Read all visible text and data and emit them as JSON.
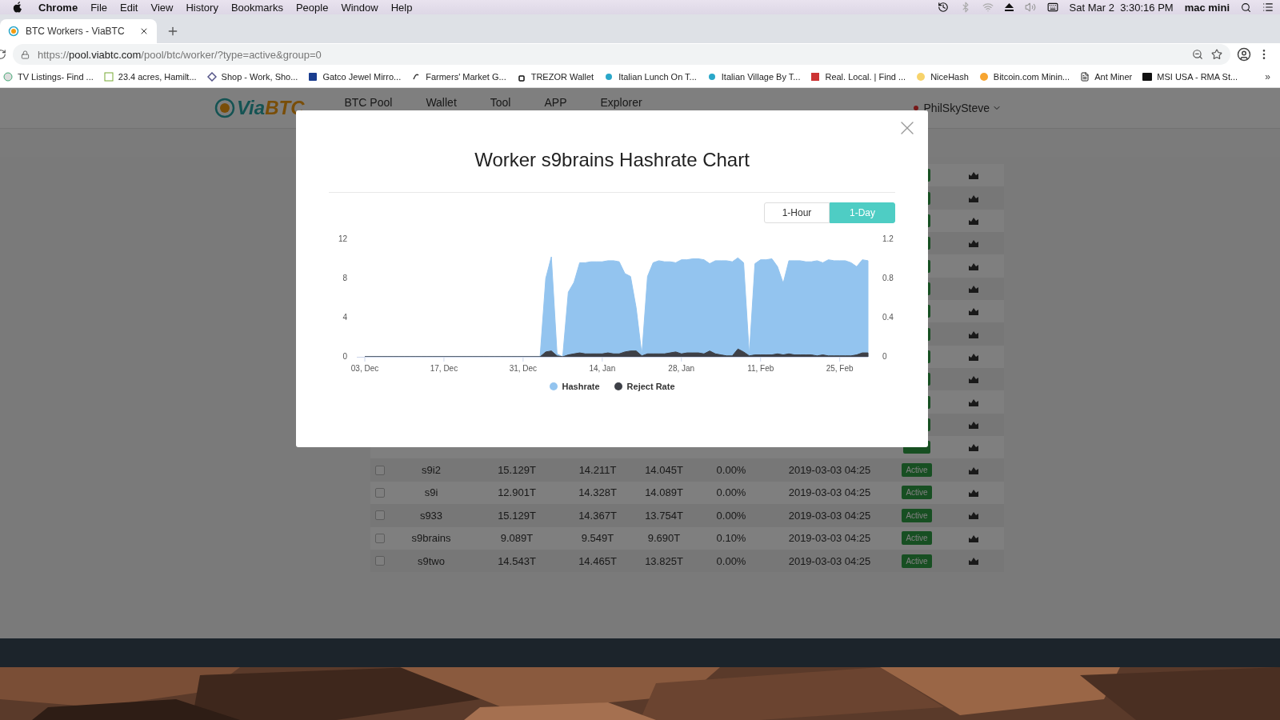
{
  "menu_bar": {
    "app": "Chrome",
    "items": [
      "File",
      "Edit",
      "View",
      "History",
      "Bookmarks",
      "People",
      "Window",
      "Help"
    ],
    "clock": "Sat Mar 2  3:30:16 PM",
    "user": "mac mini"
  },
  "browser": {
    "tab": {
      "title": "BTC Workers - ViaBTC",
      "selected": true
    },
    "url": {
      "scheme": "https://",
      "host": "pool.viabtc.com",
      "path": "/pool/btc/worker/?type=active&group=0"
    },
    "bookmarks": [
      "TV Listings- Find ...",
      "23.4 acres, Hamilt...",
      "Shop - Work, Sho...",
      "Gatco Jewel Mirro...",
      "Farmers' Market G...",
      "TREZOR Wallet",
      "Italian Lunch On T...",
      "Italian Village By T...",
      "Real. Local. | Find ...",
      "NiceHash",
      "Bitcoin.com Minin...",
      "Ant Miner",
      "MSI USA - RMA St..."
    ],
    "more": "»"
  },
  "site": {
    "logo_parts": [
      "Via",
      "BTC"
    ],
    "nav": [
      "BTC Pool",
      "Wallet",
      "Tool",
      "APP",
      "Explorer"
    ],
    "account": "PhilSkySteve"
  },
  "table": {
    "rows": [
      {
        "kind": "covered"
      },
      {
        "kind": "covered"
      },
      {
        "kind": "covered"
      },
      {
        "kind": "covered"
      },
      {
        "kind": "covered"
      },
      {
        "kind": "covered"
      },
      {
        "kind": "covered"
      },
      {
        "kind": "covered"
      },
      {
        "kind": "covered"
      },
      {
        "kind": "covered"
      },
      {
        "kind": "covered"
      },
      {
        "kind": "covered"
      },
      {
        "kind": "covered"
      },
      {
        "kind": "worker",
        "checked": false,
        "cells": [
          "s9i2",
          "15.129T",
          "14.211T",
          "14.045T",
          "0.00%",
          "2019-03-03 04:25"
        ],
        "status": "Active"
      },
      {
        "kind": "worker",
        "checked": false,
        "cells": [
          "s9i",
          "12.901T",
          "14.328T",
          "14.089T",
          "0.00%",
          "2019-03-03 04:25"
        ],
        "status": "Active"
      },
      {
        "kind": "worker",
        "checked": false,
        "cells": [
          "s933",
          "15.129T",
          "14.367T",
          "13.754T",
          "0.00%",
          "2019-03-03 04:25"
        ],
        "status": "Active"
      },
      {
        "kind": "worker",
        "checked": false,
        "cells": [
          "s9brains",
          "9.089T",
          "9.549T",
          "9.690T",
          "0.10%",
          "2019-03-03 04:25"
        ],
        "status": "Active"
      },
      {
        "kind": "worker",
        "checked": false,
        "cells": [
          "s9two",
          "14.543T",
          "14.465T",
          "13.825T",
          "0.00%",
          "2019-03-03 04:25"
        ],
        "status": "Active"
      }
    ]
  },
  "modal": {
    "title": "Worker s9brains Hashrate Chart",
    "ranges": [
      {
        "label": "1-Hour",
        "selected": false
      },
      {
        "label": "1-Day",
        "selected": true
      }
    ],
    "chart_data": {
      "type": "area",
      "categories": [
        "03, Dec",
        null,
        null,
        null,
        null,
        null,
        null,
        null,
        null,
        null,
        null,
        null,
        null,
        null,
        "17, Dec",
        null,
        null,
        null,
        null,
        null,
        null,
        null,
        null,
        null,
        null,
        null,
        null,
        null,
        "31, Dec",
        null,
        null,
        null,
        null,
        null,
        null,
        null,
        null,
        null,
        null,
        null,
        null,
        null,
        "14, Jan",
        null,
        null,
        null,
        null,
        null,
        null,
        null,
        null,
        null,
        null,
        null,
        null,
        null,
        "28, Jan",
        null,
        null,
        null,
        null,
        null,
        null,
        null,
        null,
        null,
        null,
        null,
        null,
        null,
        "11, Feb",
        null,
        null,
        null,
        null,
        null,
        null,
        null,
        null,
        null,
        null,
        null,
        null,
        null,
        "25, Feb",
        null,
        null,
        null,
        null,
        null
      ],
      "ylim": [
        0,
        12
      ],
      "yticks": [
        0,
        4,
        8,
        12
      ],
      "y2lim": [
        0,
        1.2
      ],
      "y2ticks": [
        {
          "value": 0,
          "label": "0"
        },
        {
          "value": 0.4,
          "label": "0.4"
        },
        {
          "value": 0.8,
          "label": "0.8"
        },
        {
          "value": 1.2,
          "label": "1.2"
        }
      ],
      "series": [
        {
          "name": "Hashrate",
          "color": "#93c4ef",
          "values": [
            0,
            0,
            0,
            0,
            0,
            0,
            0,
            0,
            0,
            0,
            0,
            0,
            0,
            0,
            0,
            0,
            0,
            0,
            0,
            0,
            0,
            0,
            0,
            0,
            0,
            0,
            0,
            0,
            0,
            0,
            0,
            0,
            8,
            10.2,
            0.3,
            0,
            6.6,
            7.6,
            9.6,
            9.6,
            9.7,
            9.7,
            9.7,
            9.8,
            9.8,
            9.7,
            8.5,
            8.2,
            5,
            0.2,
            8.2,
            9.6,
            9.8,
            9.7,
            9.7,
            9.6,
            9.9,
            9.9,
            10,
            10,
            9.9,
            9.5,
            9.8,
            9.8,
            9.8,
            9.7,
            10.1,
            9.6,
            0.2,
            9.5,
            9.9,
            9.9,
            10,
            9.2,
            7.5,
            9.8,
            9.8,
            9.8,
            9.7,
            9.7,
            9.8,
            9.6,
            9.9,
            9.8,
            9.8,
            9.8,
            9.6,
            9.2,
            9.9,
            9.8
          ]
        },
        {
          "name": "Reject Rate",
          "color": "#3e4047",
          "axis": "y2",
          "values": [
            0,
            0,
            0,
            0,
            0,
            0,
            0,
            0,
            0,
            0,
            0,
            0,
            0,
            0,
            0,
            0,
            0,
            0,
            0,
            0,
            0,
            0,
            0,
            0,
            0,
            0,
            0,
            0,
            0,
            0,
            0,
            0,
            0.05,
            0.06,
            0.01,
            0,
            0.02,
            0.03,
            0.04,
            0.03,
            0.03,
            0.03,
            0.03,
            0.04,
            0.03,
            0.03,
            0.05,
            0.06,
            0.06,
            0.01,
            0.03,
            0.03,
            0.03,
            0.03,
            0.04,
            0.05,
            0.03,
            0.04,
            0.04,
            0.04,
            0.03,
            0.06,
            0.03,
            0.02,
            0.01,
            0.01,
            0.08,
            0.05,
            0.01,
            0.02,
            0.02,
            0.02,
            0.02,
            0.03,
            0.02,
            0.03,
            0.02,
            0.02,
            0.02,
            0.02,
            0.01,
            0.02,
            0.01,
            0.01,
            0.01,
            0.01,
            0.01,
            0.02,
            0.04,
            0.04
          ]
        }
      ]
    }
  }
}
